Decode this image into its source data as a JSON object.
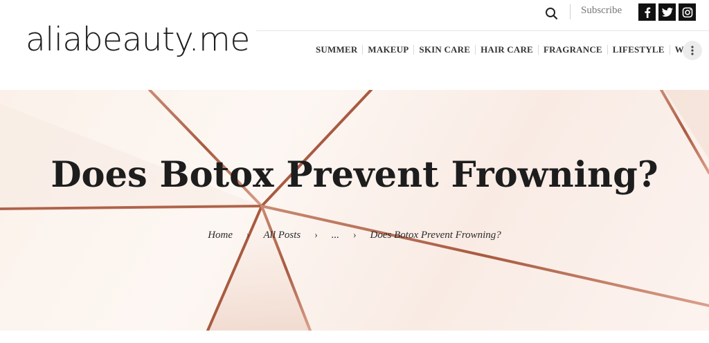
{
  "site": {
    "logo_text": "aliabeauty.me"
  },
  "header": {
    "subscribe_label": "Subscribe",
    "social": [
      {
        "name": "facebook",
        "icon": "facebook-icon"
      },
      {
        "name": "twitter",
        "icon": "twitter-icon"
      },
      {
        "name": "instagram",
        "icon": "instagram-icon"
      }
    ],
    "search_icon": "search-icon",
    "more_icon": "vertical-ellipsis-icon"
  },
  "nav": {
    "items": [
      "SUMMER",
      "MAKEUP",
      "SKIN CARE",
      "HAIR CARE",
      "FRAGRANCE",
      "LIFESTYLE",
      "WIN"
    ]
  },
  "hero": {
    "title": "Does Botox Prevent Frowning?",
    "breadcrumb": {
      "home": "Home",
      "all_posts": "All Posts",
      "ellipsis": "...",
      "current": "Does Botox Prevent Frowning?",
      "separator": "›"
    }
  },
  "colors": {
    "accent_rose_gold": "#b5654a",
    "hero_bg": "#fbf1ea",
    "social_bg": "#111111"
  }
}
